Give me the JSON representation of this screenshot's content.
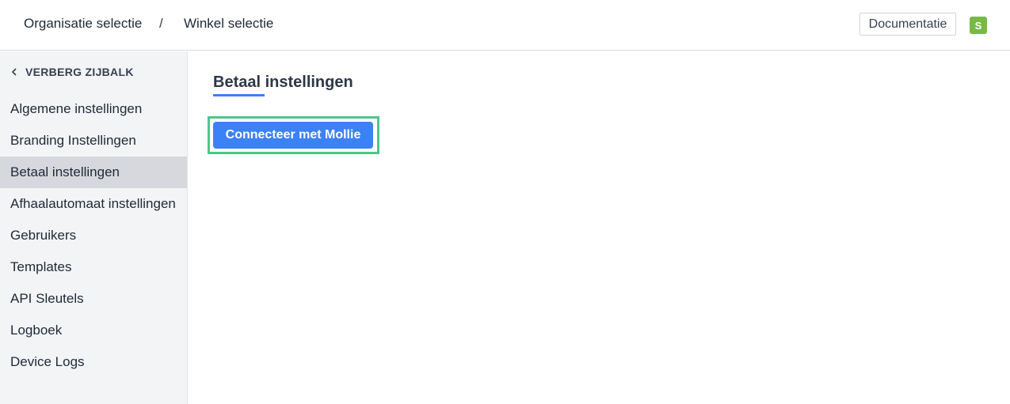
{
  "header": {
    "breadcrumb_org": "Organisatie selectie",
    "breadcrumb_sep": "/",
    "breadcrumb_store": "Winkel selectie",
    "docs_label": "Documentatie",
    "avatar_initial": "S",
    "avatar_color": "#78b946"
  },
  "sidebar": {
    "hide_label": "VERBERG ZIJBALK",
    "items": [
      {
        "label": "Algemene instellingen"
      },
      {
        "label": "Branding Instellingen"
      },
      {
        "label": "Betaal instellingen",
        "active": true
      },
      {
        "label": "Afhaalautomaat instellingen"
      },
      {
        "label": "Gebruikers"
      },
      {
        "label": "Templates"
      },
      {
        "label": "API Sleutels"
      },
      {
        "label": "Logboek"
      },
      {
        "label": "Device Logs"
      }
    ]
  },
  "main": {
    "title": "Betaal instellingen",
    "connect_button": "Connecteer met Mollie"
  },
  "colors": {
    "accent": "#3b82f6",
    "highlight_outline": "#4cc78c",
    "sidebar_bg": "#f3f4f6",
    "active_item_bg": "#d6d8dd"
  }
}
